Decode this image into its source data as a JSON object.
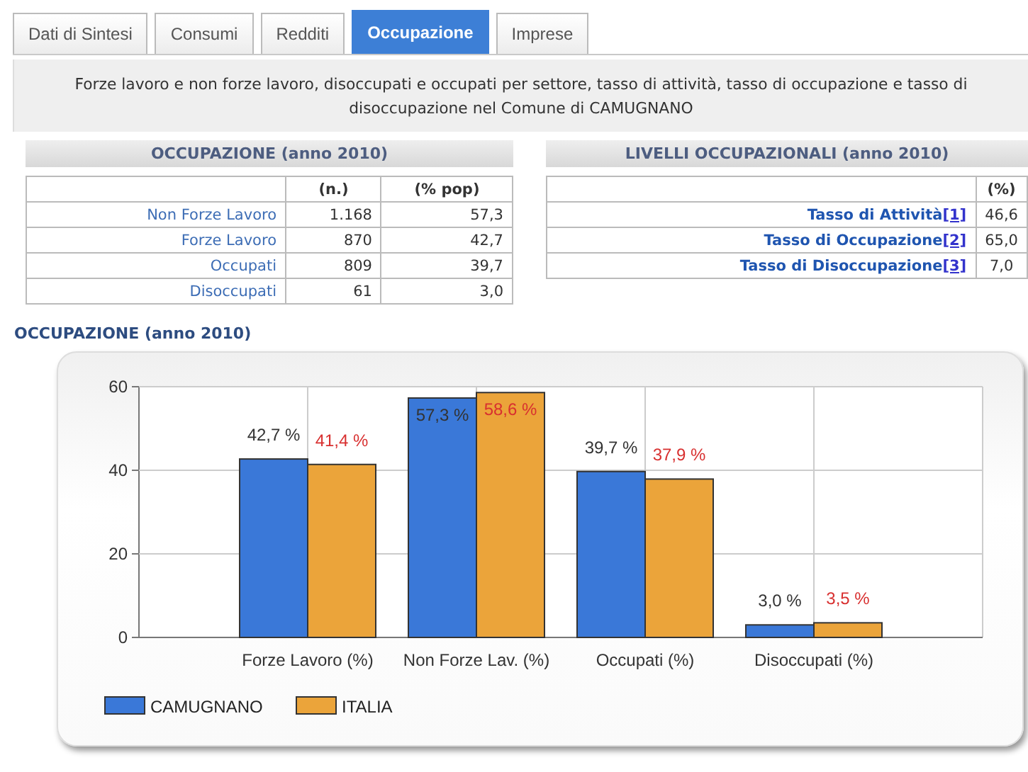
{
  "tabs": [
    {
      "label": "Dati di Sintesi",
      "selected": false
    },
    {
      "label": "Consumi",
      "selected": false
    },
    {
      "label": "Redditi",
      "selected": false
    },
    {
      "label": "Occupazione",
      "selected": true
    },
    {
      "label": "Imprese",
      "selected": false
    }
  ],
  "description": "Forze lavoro e non forze lavoro, disoccupati e occupati per settore, tasso di attività, tasso di occupazione e tasso di disoccupazione nel Comune di CAMUGNANO",
  "occupazione_table": {
    "title": "OCCUPAZIONE (anno 2010)",
    "columns": [
      "(n.)",
      "(% pop)"
    ],
    "rows": [
      {
        "label": "Non Forze Lavoro",
        "values": [
          "1.168",
          "57,3"
        ]
      },
      {
        "label": "Forze Lavoro",
        "values": [
          "870",
          "42,7"
        ]
      },
      {
        "label": "Occupati",
        "values": [
          "809",
          "39,7"
        ]
      },
      {
        "label": "Disoccupati",
        "values": [
          "61",
          "3,0"
        ]
      }
    ]
  },
  "livelli_table": {
    "title": "LIVELLI OCCUPAZIONALI (anno 2010)",
    "columns": [
      "(%)"
    ],
    "rows": [
      {
        "label": "Tasso di Attività",
        "note": "[1]",
        "values": [
          "46,6"
        ]
      },
      {
        "label": "Tasso di Occupazione",
        "note": "[2]",
        "values": [
          "65,0"
        ]
      },
      {
        "label": "Tasso di Disoccupazione",
        "note": "[3]",
        "values": [
          "7,0"
        ]
      }
    ]
  },
  "chart_section": {
    "title": "OCCUPAZIONE (anno 2010)",
    "chart_data": {
      "type": "bar",
      "categories": [
        "Forze Lavoro (%)",
        "Non Forze Lav. (%)",
        "Occupati (%)",
        "Disoccupati (%)"
      ],
      "series": [
        {
          "name": "CAMUGNANO",
          "color": "#3a78d8",
          "values": [
            42.7,
            57.3,
            39.7,
            3.0
          ],
          "value_labels": [
            "42,7 %",
            "57,3 %",
            "39,7 %",
            "3,0 %"
          ]
        },
        {
          "name": "ITALIA",
          "color": "#eba43a",
          "values": [
            41.4,
            58.6,
            37.9,
            3.5
          ],
          "value_labels": [
            "41,4 %",
            "58,6 %",
            "37,9 %",
            "3,5 %"
          ]
        }
      ],
      "ylim": [
        0,
        60
      ],
      "yticks": [
        0,
        20,
        40,
        60
      ],
      "grid": true,
      "legend": true
    }
  }
}
